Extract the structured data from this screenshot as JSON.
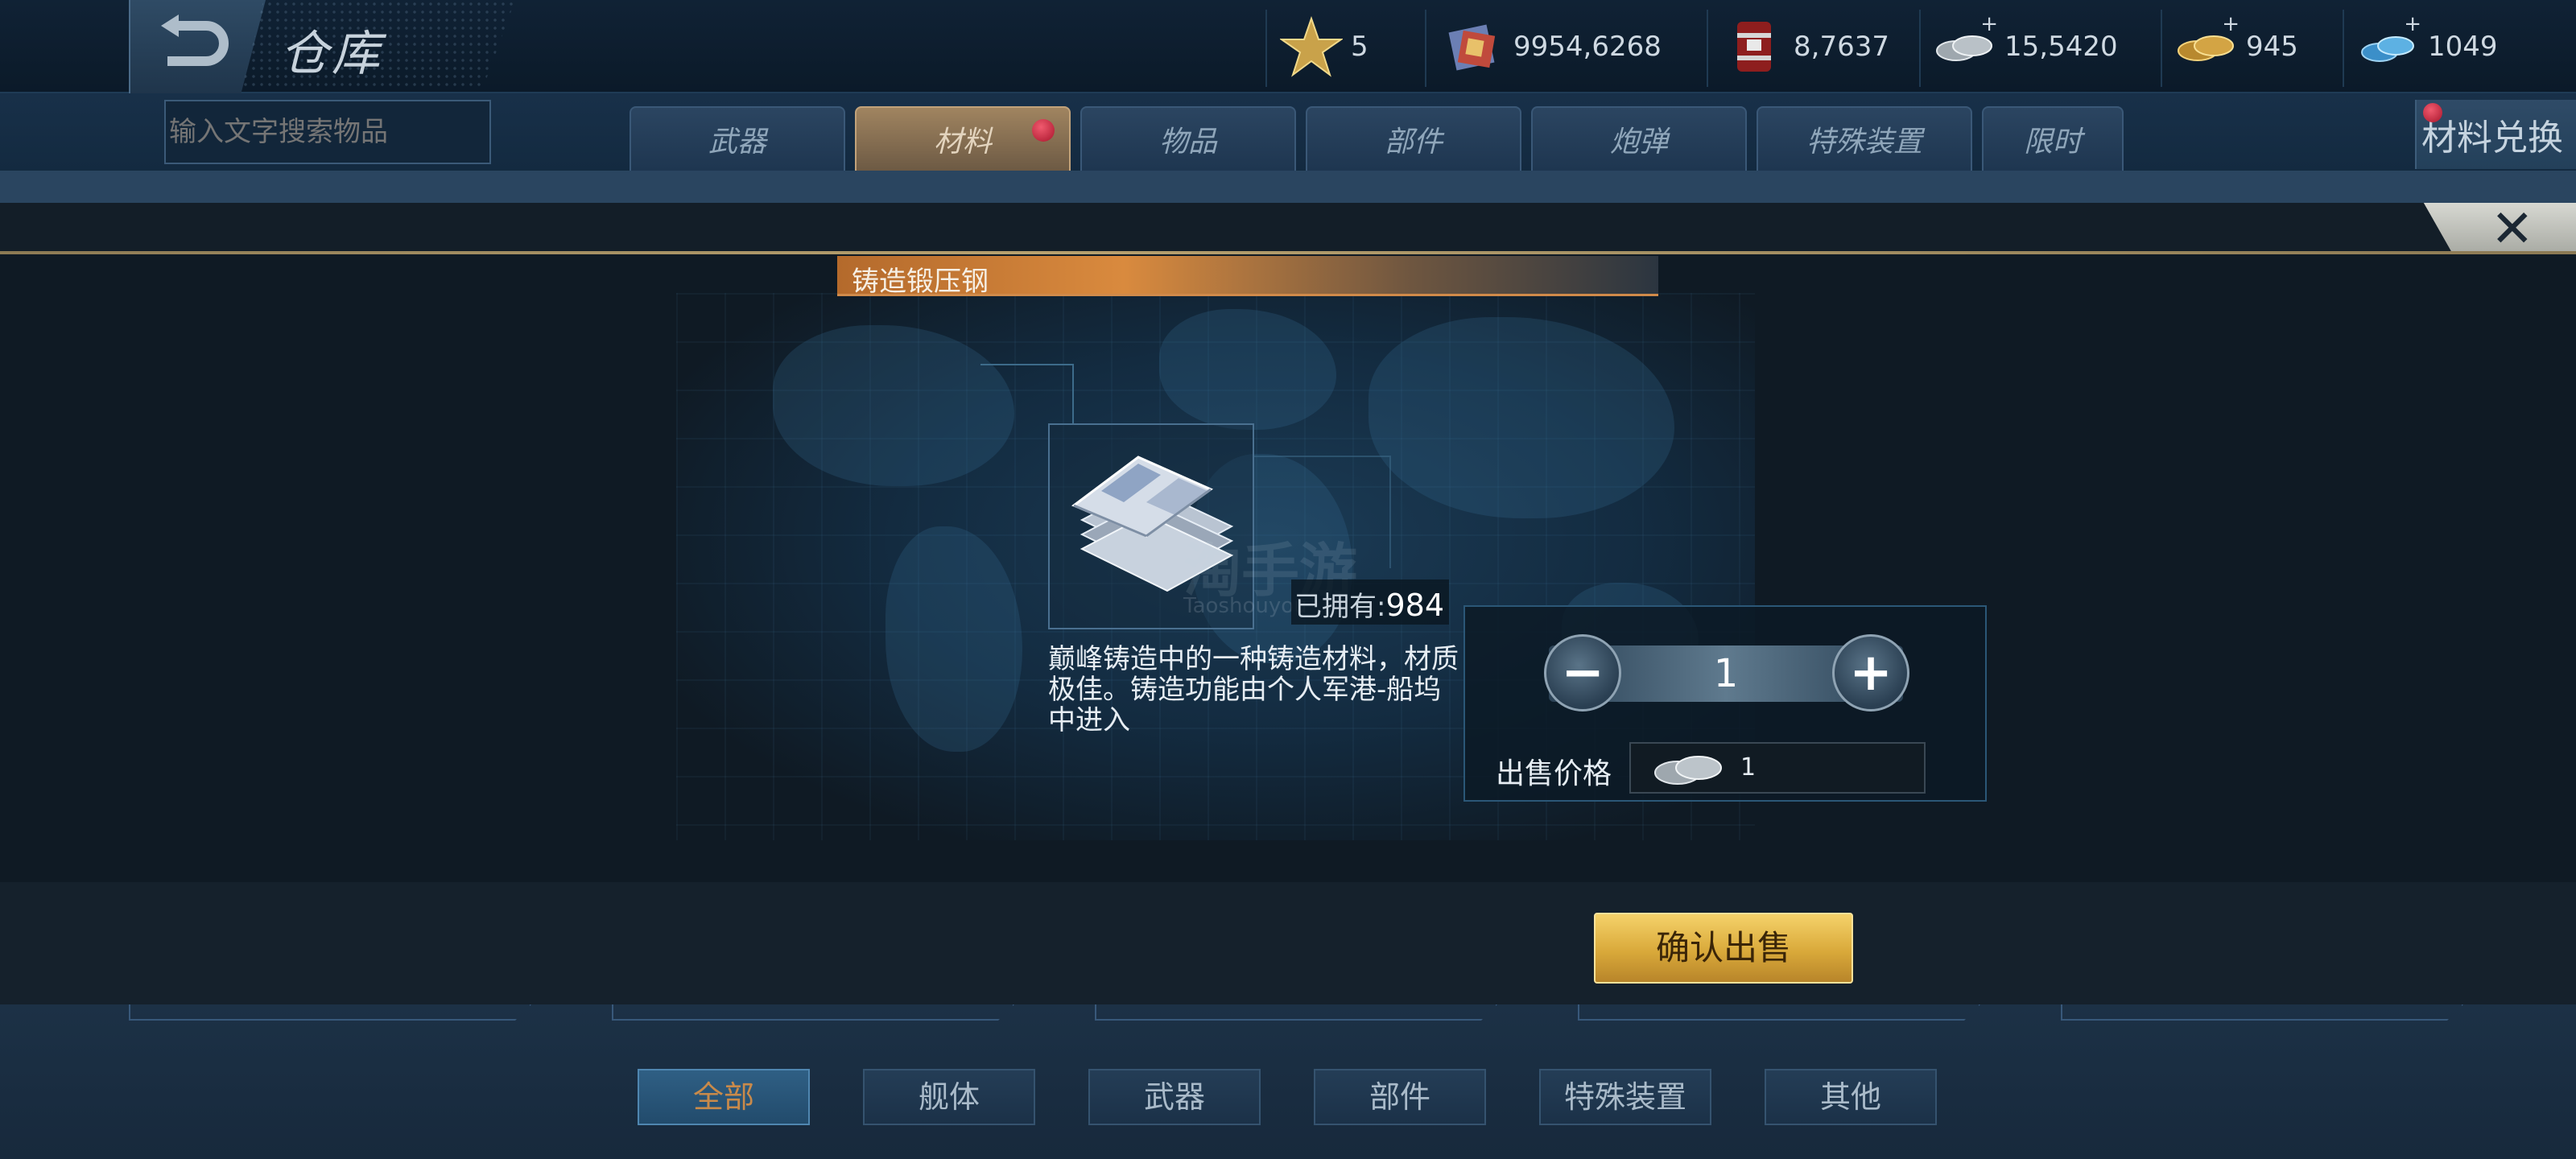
{
  "header": {
    "title": "仓库",
    "resources": [
      {
        "icon": "star-icon",
        "value": "5",
        "has_plus": false
      },
      {
        "icon": "supply-crate-icon",
        "value": "9954,6268",
        "has_plus": false
      },
      {
        "icon": "fuel-barrel-icon",
        "value": "8,7637",
        "has_plus": false
      },
      {
        "icon": "silver-coins-icon",
        "value": "15,5420",
        "has_plus": true
      },
      {
        "icon": "gold-coins-icon",
        "value": "945",
        "has_plus": true
      },
      {
        "icon": "diamond-icon",
        "value": "1049",
        "has_plus": true
      }
    ],
    "plus_symbol": "+"
  },
  "search": {
    "placeholder": "输入文字搜索物品"
  },
  "tabs": [
    {
      "label": "武器",
      "active": false
    },
    {
      "label": "材料",
      "active": true,
      "badge": true
    },
    {
      "label": "物品",
      "active": false
    },
    {
      "label": "部件",
      "active": false
    },
    {
      "label": "炮弹",
      "active": false
    },
    {
      "label": "特殊装置",
      "active": false
    },
    {
      "label": "限时",
      "active": false
    }
  ],
  "exchange_button": {
    "label": "材料兑换",
    "badge": true
  },
  "dialog": {
    "item_name": "铸造锻压钢",
    "item_icon": "steel-plates-icon",
    "owned_label": "已拥有:",
    "owned_count": "984",
    "description": "巅峰铸造中的一种铸造材料，材质极佳。铸造功能由个人军港-船坞中进入",
    "quantity": "1",
    "minus_symbol": "−",
    "plus_symbol": "+",
    "price_label": "出售价格",
    "price_icon": "silver-coins-icon",
    "price_value": "1",
    "confirm_label": "确认出售",
    "close_symbol": "✕",
    "watermark": "淘手游",
    "watermark_en": "Taoshouyou"
  },
  "bottom_filters": [
    {
      "label": "全部",
      "active": true
    },
    {
      "label": "舰体",
      "active": false
    },
    {
      "label": "武器",
      "active": false
    },
    {
      "label": "部件",
      "active": false
    },
    {
      "label": "特殊装置",
      "active": false
    },
    {
      "label": "其他",
      "active": false
    }
  ],
  "colors": {
    "accent_gold": "#d9a93a",
    "header_orange": "#d98a3e",
    "badge_red": "#c91f36",
    "panel_bg": "#0f1a24"
  }
}
